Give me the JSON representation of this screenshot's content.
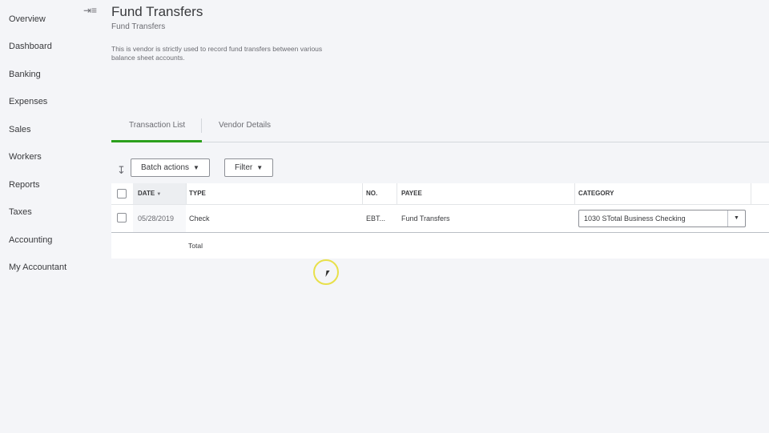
{
  "sidebar": {
    "items": [
      {
        "label": "Overview"
      },
      {
        "label": "Dashboard"
      },
      {
        "label": "Banking"
      },
      {
        "label": "Expenses"
      },
      {
        "label": "Sales"
      },
      {
        "label": "Workers"
      },
      {
        "label": "Reports"
      },
      {
        "label": "Taxes"
      },
      {
        "label": "Accounting"
      },
      {
        "label": "My Accountant"
      }
    ],
    "collapse_icon": "⇥≡"
  },
  "header": {
    "title": "Fund Transfers",
    "subtitle": "Fund Transfers",
    "description": "This is vendor is strictly used to record fund transfers between various balance sheet accounts."
  },
  "tabs": [
    {
      "label": "Transaction List",
      "active": true
    },
    {
      "label": "Vendor Details",
      "active": false
    }
  ],
  "toolbar": {
    "batch_actions_label": "Batch actions",
    "filter_label": "Filter"
  },
  "table": {
    "columns": [
      "DATE",
      "TYPE",
      "NO.",
      "PAYEE",
      "CATEGORY"
    ],
    "rows": [
      {
        "date": "05/28/2019",
        "type": "Check",
        "no": "EBT...",
        "payee": "Fund Transfers",
        "category": "1030 STotal Business Checking"
      }
    ],
    "total_label": "Total"
  },
  "colors": {
    "accent": "#2ca01c",
    "cursor_highlight": "#e8e04a"
  }
}
